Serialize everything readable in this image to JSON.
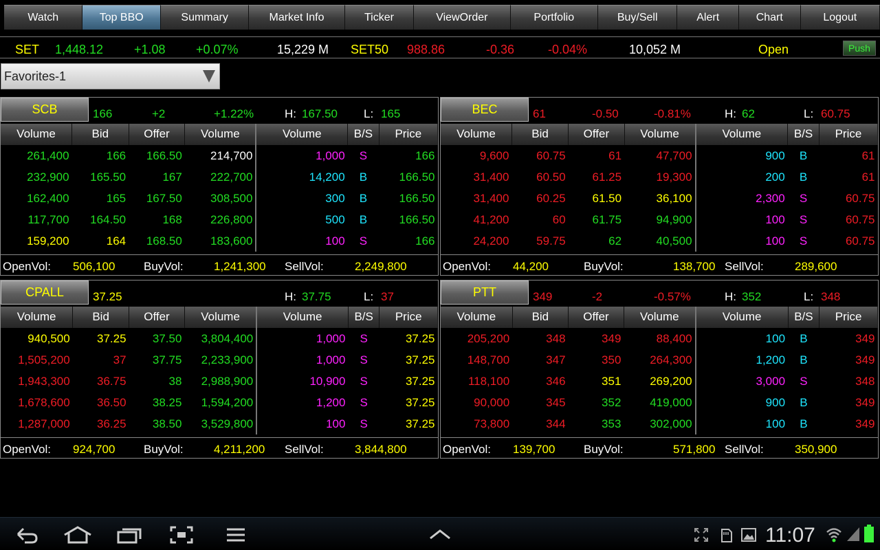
{
  "nav": [
    "Watch",
    "Top BBO",
    "Summary",
    "Market Info",
    "Ticker",
    "ViewOrder",
    "Portfolio",
    "Buy/Sell",
    "Alert",
    "Chart",
    "Logout"
  ],
  "nav_active": "Top BBO",
  "index": {
    "set_name": "SET",
    "set_value": "1,448.12",
    "set_change": "+1.08",
    "set_pct": "+0.07%",
    "set_vol": "15,229 M",
    "set50_name": "SET50",
    "set50_value": "988.86",
    "set50_change": "-0.36",
    "set50_pct": "-0.04%",
    "set50_vol": "10,052 M",
    "status": "Open",
    "push": "Push"
  },
  "dropdown": "Favorites-1",
  "headers": {
    "vol": "Volume",
    "bid": "Bid",
    "offer": "Offer",
    "bs": "B/S",
    "price": "Price",
    "h": "H:",
    "l": "L:"
  },
  "footer_labels": {
    "open": "OpenVol:",
    "buy": "BuyVol:",
    "sell": "SellVol:"
  },
  "colors": {
    "up": "#22dd22",
    "down": "#ee1c25",
    "unchanged": "#ffff00",
    "buy": "#1ee6ff",
    "sell": "#ff22ff"
  },
  "panels": [
    {
      "symbol": "SCB",
      "last": "166",
      "change": "+2",
      "pct": "+1.22%",
      "high": "167.50",
      "low": "165",
      "last_c": "g",
      "chg_c": "g",
      "h_c": "g",
      "l_c": "g",
      "rows": [
        {
          "bv": "261,400",
          "bv_c": "g",
          "bid": "166",
          "bid_c": "g",
          "off": "166.50",
          "off_c": "g",
          "ov": "214,700",
          "ov_c": "w"
        },
        {
          "bv": "232,900",
          "bv_c": "g",
          "bid": "165.50",
          "bid_c": "g",
          "off": "167",
          "off_c": "g",
          "ov": "222,700",
          "ov_c": "g"
        },
        {
          "bv": "162,400",
          "bv_c": "g",
          "bid": "165",
          "bid_c": "g",
          "off": "167.50",
          "off_c": "g",
          "ov": "308,500",
          "ov_c": "g"
        },
        {
          "bv": "117,700",
          "bv_c": "g",
          "bid": "164.50",
          "bid_c": "g",
          "off": "168",
          "off_c": "g",
          "ov": "226,800",
          "ov_c": "g"
        },
        {
          "bv": "159,200",
          "bv_c": "y",
          "bid": "164",
          "bid_c": "y",
          "off": "168.50",
          "off_c": "g",
          "ov": "183,600",
          "ov_c": "g"
        }
      ],
      "ticks": [
        {
          "v": "1,000",
          "v_c": "m",
          "bs": "S",
          "p": "166",
          "p_c": "g"
        },
        {
          "v": "14,200",
          "v_c": "c",
          "bs": "B",
          "p": "166.50",
          "p_c": "g"
        },
        {
          "v": "300",
          "v_c": "c",
          "bs": "B",
          "p": "166.50",
          "p_c": "g"
        },
        {
          "v": "500",
          "v_c": "c",
          "bs": "B",
          "p": "166.50",
          "p_c": "g"
        },
        {
          "v": "100",
          "v_c": "m",
          "bs": "S",
          "p": "166",
          "p_c": "g"
        }
      ],
      "open": "506,100",
      "buy": "1,241,300",
      "sell": "2,249,800"
    },
    {
      "symbol": "BEC",
      "last": "61",
      "change": "-0.50",
      "pct": "-0.81%",
      "high": "62",
      "low": "60.75",
      "last_c": "r",
      "chg_c": "r",
      "h_c": "g",
      "l_c": "r",
      "rows": [
        {
          "bv": "9,600",
          "bv_c": "r",
          "bid": "60.75",
          "bid_c": "r",
          "off": "61",
          "off_c": "r",
          "ov": "47,700",
          "ov_c": "r"
        },
        {
          "bv": "31,400",
          "bv_c": "r",
          "bid": "60.50",
          "bid_c": "r",
          "off": "61.25",
          "off_c": "r",
          "ov": "19,300",
          "ov_c": "r"
        },
        {
          "bv": "31,400",
          "bv_c": "r",
          "bid": "60.25",
          "bid_c": "r",
          "off": "61.50",
          "off_c": "y",
          "ov": "36,100",
          "ov_c": "y"
        },
        {
          "bv": "41,200",
          "bv_c": "r",
          "bid": "60",
          "bid_c": "r",
          "off": "61.75",
          "off_c": "g",
          "ov": "94,900",
          "ov_c": "g"
        },
        {
          "bv": "24,200",
          "bv_c": "r",
          "bid": "59.75",
          "bid_c": "r",
          "off": "62",
          "off_c": "g",
          "ov": "40,500",
          "ov_c": "g"
        }
      ],
      "ticks": [
        {
          "v": "900",
          "v_c": "c",
          "bs": "B",
          "p": "61",
          "p_c": "r"
        },
        {
          "v": "200",
          "v_c": "c",
          "bs": "B",
          "p": "61",
          "p_c": "r"
        },
        {
          "v": "2,300",
          "v_c": "m",
          "bs": "S",
          "p": "60.75",
          "p_c": "r"
        },
        {
          "v": "100",
          "v_c": "m",
          "bs": "S",
          "p": "60.75",
          "p_c": "r"
        },
        {
          "v": "100",
          "v_c": "m",
          "bs": "S",
          "p": "60.75",
          "p_c": "r"
        }
      ],
      "open": "44,200",
      "buy": "138,700",
      "sell": "289,600"
    },
    {
      "symbol": "CPALL",
      "last": "37.25",
      "change": "",
      "pct": "",
      "high": "37.75",
      "low": "37",
      "last_c": "y",
      "chg_c": "y",
      "h_c": "g",
      "l_c": "r",
      "rows": [
        {
          "bv": "940,500",
          "bv_c": "y",
          "bid": "37.25",
          "bid_c": "y",
          "off": "37.50",
          "off_c": "g",
          "ov": "3,804,400",
          "ov_c": "g"
        },
        {
          "bv": "1,505,200",
          "bv_c": "r",
          "bid": "37",
          "bid_c": "r",
          "off": "37.75",
          "off_c": "g",
          "ov": "2,233,900",
          "ov_c": "g"
        },
        {
          "bv": "1,943,300",
          "bv_c": "r",
          "bid": "36.75",
          "bid_c": "r",
          "off": "38",
          "off_c": "g",
          "ov": "2,988,900",
          "ov_c": "g"
        },
        {
          "bv": "1,678,600",
          "bv_c": "r",
          "bid": "36.50",
          "bid_c": "r",
          "off": "38.25",
          "off_c": "g",
          "ov": "1,594,200",
          "ov_c": "g"
        },
        {
          "bv": "1,287,000",
          "bv_c": "r",
          "bid": "36.25",
          "bid_c": "r",
          "off": "38.50",
          "off_c": "g",
          "ov": "3,529,800",
          "ov_c": "g"
        }
      ],
      "ticks": [
        {
          "v": "1,000",
          "v_c": "m",
          "bs": "S",
          "p": "37.25",
          "p_c": "y"
        },
        {
          "v": "1,000",
          "v_c": "m",
          "bs": "S",
          "p": "37.25",
          "p_c": "y"
        },
        {
          "v": "10,900",
          "v_c": "m",
          "bs": "S",
          "p": "37.25",
          "p_c": "y"
        },
        {
          "v": "1,200",
          "v_c": "m",
          "bs": "S",
          "p": "37.25",
          "p_c": "y"
        },
        {
          "v": "100",
          "v_c": "m",
          "bs": "S",
          "p": "37.25",
          "p_c": "y"
        }
      ],
      "open": "924,700",
      "buy": "4,211,200",
      "sell": "3,844,800"
    },
    {
      "symbol": "PTT",
      "last": "349",
      "change": "-2",
      "pct": "-0.57%",
      "high": "352",
      "low": "348",
      "last_c": "r",
      "chg_c": "r",
      "h_c": "g",
      "l_c": "r",
      "rows": [
        {
          "bv": "205,200",
          "bv_c": "r",
          "bid": "348",
          "bid_c": "r",
          "off": "349",
          "off_c": "r",
          "ov": "88,400",
          "ov_c": "r"
        },
        {
          "bv": "148,700",
          "bv_c": "r",
          "bid": "347",
          "bid_c": "r",
          "off": "350",
          "off_c": "r",
          "ov": "264,300",
          "ov_c": "r"
        },
        {
          "bv": "118,100",
          "bv_c": "r",
          "bid": "346",
          "bid_c": "r",
          "off": "351",
          "off_c": "y",
          "ov": "269,200",
          "ov_c": "y"
        },
        {
          "bv": "90,000",
          "bv_c": "r",
          "bid": "345",
          "bid_c": "r",
          "off": "352",
          "off_c": "g",
          "ov": "419,000",
          "ov_c": "g"
        },
        {
          "bv": "73,800",
          "bv_c": "r",
          "bid": "344",
          "bid_c": "r",
          "off": "353",
          "off_c": "g",
          "ov": "302,000",
          "ov_c": "g"
        }
      ],
      "ticks": [
        {
          "v": "100",
          "v_c": "c",
          "bs": "B",
          "p": "349",
          "p_c": "r"
        },
        {
          "v": "1,200",
          "v_c": "c",
          "bs": "B",
          "p": "349",
          "p_c": "r"
        },
        {
          "v": "3,000",
          "v_c": "m",
          "bs": "S",
          "p": "348",
          "p_c": "r"
        },
        {
          "v": "900",
          "v_c": "c",
          "bs": "B",
          "p": "349",
          "p_c": "r"
        },
        {
          "v": "100",
          "v_c": "c",
          "bs": "B",
          "p": "349",
          "p_c": "r"
        }
      ],
      "open": "139,700",
      "buy": "571,800",
      "sell": "350,900"
    }
  ],
  "system": {
    "clock": "11:07",
    "icons": [
      "back-icon",
      "home-icon",
      "recent-apps-icon",
      "screenshot-icon",
      "menu-icon",
      "expand-up-icon",
      "fullscreen-icon",
      "sd-card-icon",
      "gallery-icon",
      "wifi-icon",
      "signal-icon",
      "battery-icon"
    ]
  }
}
